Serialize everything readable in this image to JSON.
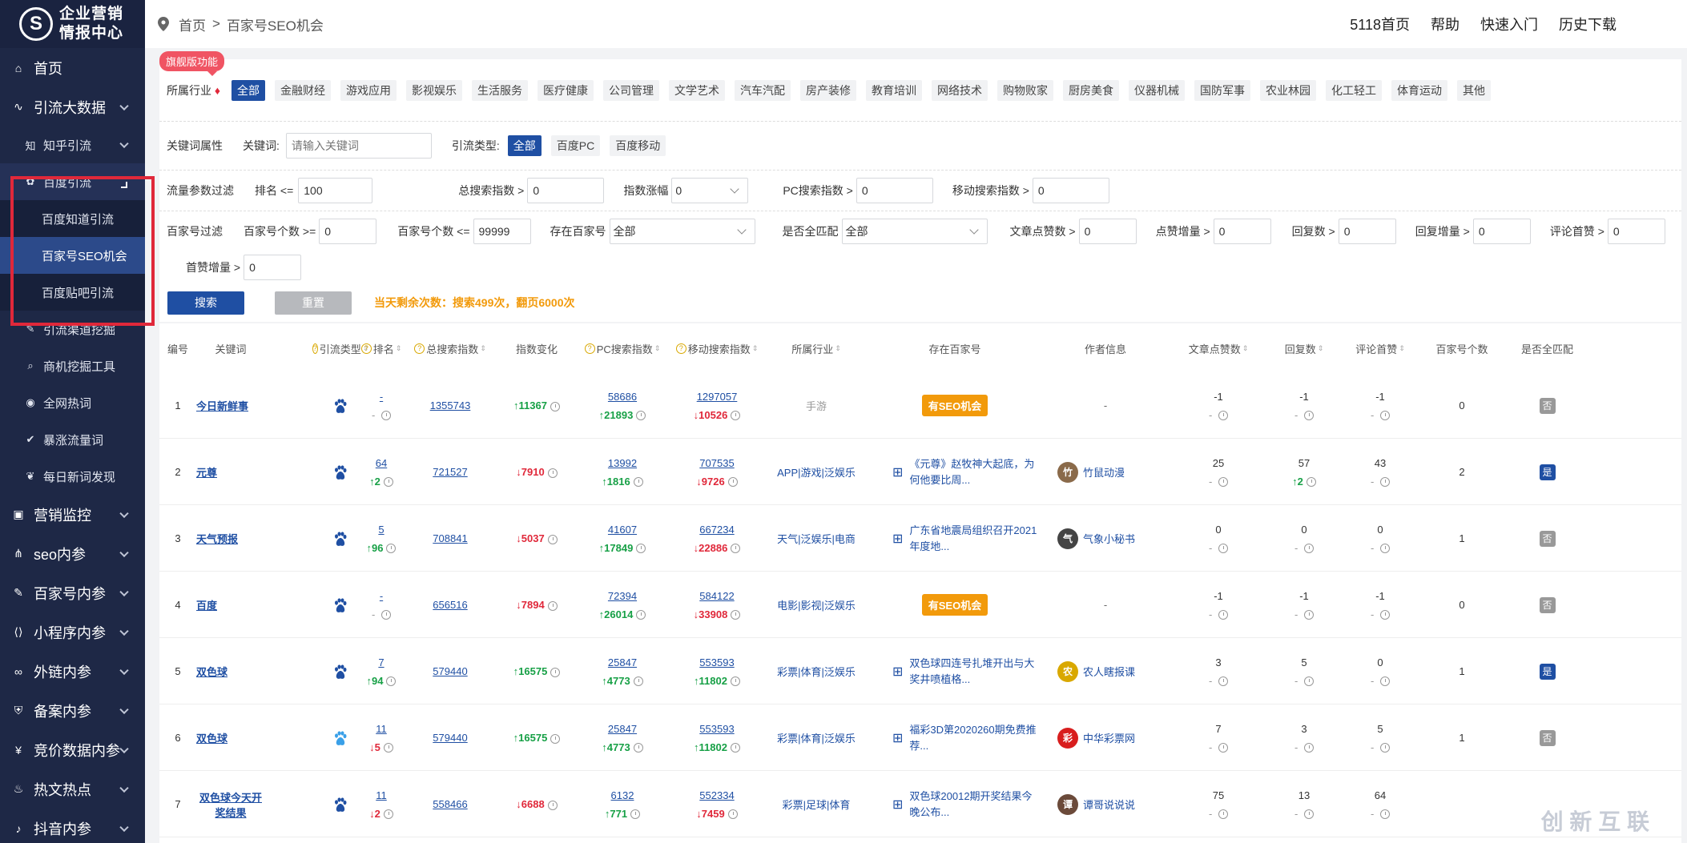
{
  "logo": {
    "line1": "企业营销",
    "line2": "情报中心"
  },
  "sidebar": {
    "home": "首页",
    "traffic": "引流大数据",
    "zhihu": "知乎引流",
    "baidu": "百度引流",
    "baidu_sub": [
      "百度知道引流",
      "百家号SEO机会",
      "百度贴吧引流"
    ],
    "others": [
      "引流渠道挖掘",
      "商机挖掘工具",
      "全网热词",
      "暴涨流量词",
      "每日新词发现"
    ],
    "groups": [
      "营销监控",
      "seo内参",
      "百家号内参",
      "小程序内参",
      "外链内参",
      "备案内参",
      "竞价数据内参",
      "热文热点",
      "抖音内参"
    ]
  },
  "breadcrumb": {
    "home": "首页",
    "sep": ">",
    "current": "百家号SEO机会"
  },
  "top_links": [
    "5118首页",
    "帮助",
    "快速入门",
    "历史下载"
  ],
  "filters": {
    "flag": "旗舰版功能",
    "industry_label": "所属行业",
    "industries": [
      "全部",
      "金融财经",
      "游戏应用",
      "影视娱乐",
      "生活服务",
      "医疗健康",
      "公司管理",
      "文学艺术",
      "汽车汽配",
      "房产装修",
      "教育培训",
      "网络技术",
      "购物败家",
      "厨房美食",
      "仪器机械",
      "国防军事",
      "农业林园",
      "化工轻工",
      "体育运动",
      "其他"
    ],
    "kw_attr": "关键词属性",
    "kw_label": "关键词:",
    "kw_placeholder": "请输入关键词",
    "type_label": "引流类型:",
    "types": [
      "全部",
      "百度PC",
      "百度移动"
    ],
    "flow_label": "流量参数过滤",
    "rank_label": "排名 <=",
    "rank_value": "100",
    "total_label": "总搜索指数 >",
    "total_value": "0",
    "change_label": "指数涨幅",
    "change_value": "0",
    "pc_label": "PC搜索指数 >",
    "pc_value": "0",
    "mobile_label": "移动搜索指数 >",
    "mobile_value": "0",
    "bjh_label": "百家号过滤",
    "bjh_min_label": "百家号个数 >=",
    "bjh_min_value": "0",
    "bjh_max_label": "百家号个数 <=",
    "bjh_max_value": "99999",
    "exist_label": "存在百家号",
    "exist_value": "全部",
    "match_label": "是否全匹配",
    "match_value": "全部",
    "likes_label": "文章点赞数 >",
    "likes_value": "0",
    "like_inc_label": "点赞增量 >",
    "like_inc_value": "0",
    "reply_label": "回复数 >",
    "reply_value": "0",
    "reply_inc_label": "回复增量 >",
    "reply_inc_value": "0",
    "first_like_label": "评论首赞 >",
    "first_like_value": "0",
    "first_inc_label": "首赞增量 >",
    "first_inc_value": "0",
    "search_btn": "搜索",
    "reset_btn": "重置",
    "remaining": "当天剩余次数：搜索499次，翻页6000次"
  },
  "table": {
    "headers": [
      "编号",
      "关键词",
      "引流类型",
      "排名",
      "总搜索指数",
      "指数变化",
      "PC搜索指数",
      "移动搜索指数",
      "所属行业",
      "存在百家号",
      "作者信息",
      "文章点赞数",
      "回复数",
      "评论首赞",
      "百家号个数",
      "是否全匹配"
    ],
    "rows": [
      {
        "no": "1",
        "kw": "今日新鲜事",
        "paw": "#1f4fa3",
        "rank": "-",
        "rank_sub": "-",
        "total": "1355743",
        "chg": "11367",
        "chg_dir": "up",
        "pc": "58686",
        "pc_chg": "21893",
        "pc_dir": "up",
        "mob": "1297057",
        "mob_chg": "10526",
        "mob_dir": "down",
        "ind": "手游",
        "ind_gray": true,
        "seo": "有SEO机会",
        "art": "",
        "author": "-",
        "av": "",
        "avc": "",
        "likes": "-1",
        "reply": "-1",
        "reply_chg": "",
        "first": "-1",
        "count": "0",
        "match": "否"
      },
      {
        "no": "2",
        "kw": "元尊",
        "paw": "#1f4fa3",
        "rank": "64",
        "rank_sub": "2",
        "total": "721527",
        "chg": "7910",
        "chg_dir": "down",
        "pc": "13992",
        "pc_chg": "1816",
        "pc_dir": "up",
        "mob": "707535",
        "mob_chg": "9726",
        "mob_dir": "down",
        "ind": "APP|游戏|泛娱乐",
        "ind_gray": false,
        "seo": "",
        "art": "《元尊》赵牧神大起底，为何他要比周...",
        "author": "竹鼠动漫",
        "av": "竹",
        "avc": "#8a6a4a",
        "likes": "25",
        "reply": "57",
        "reply_chg": "2",
        "first": "43",
        "count": "2",
        "match": "是"
      },
      {
        "no": "3",
        "kw": "天气预报",
        "paw": "#1f4fa3",
        "rank": "5",
        "rank_sub": "96",
        "total": "708841",
        "chg": "5037",
        "chg_dir": "down",
        "pc": "41607",
        "pc_chg": "17849",
        "pc_dir": "up",
        "mob": "667234",
        "mob_chg": "22886",
        "mob_dir": "down",
        "ind": "天气|泛娱乐|电商",
        "ind_gray": false,
        "seo": "",
        "art": "广东省地震局组织召开2021年度地...",
        "author": "气象小秘书",
        "av": "气",
        "avc": "#444",
        "likes": "0",
        "reply": "0",
        "reply_chg": "",
        "first": "0",
        "count": "1",
        "match": "否"
      },
      {
        "no": "4",
        "kw": "百度",
        "paw": "#1f4fa3",
        "rank": "-",
        "rank_sub": "-",
        "total": "656516",
        "chg": "7894",
        "chg_dir": "down",
        "pc": "72394",
        "pc_chg": "26014",
        "pc_dir": "up",
        "mob": "584122",
        "mob_chg": "33908",
        "mob_dir": "down",
        "ind": "电影|影视|泛娱乐",
        "ind_gray": false,
        "seo": "有SEO机会",
        "art": "",
        "author": "-",
        "av": "",
        "avc": "",
        "likes": "-1",
        "reply": "-1",
        "reply_chg": "",
        "first": "-1",
        "count": "0",
        "match": "否"
      },
      {
        "no": "5",
        "kw": "双色球",
        "paw": "#1f4fa3",
        "rank": "7",
        "rank_sub": "94",
        "total": "579440",
        "chg": "16575",
        "chg_dir": "up",
        "pc": "25847",
        "pc_chg": "4773",
        "pc_dir": "up",
        "mob": "553593",
        "mob_chg": "11802",
        "mob_dir": "up",
        "ind": "彩票|体育|泛娱乐",
        "ind_gray": false,
        "seo": "",
        "art": "双色球四连号扎堆开出与大奖井喷植格...",
        "author": "农人瞎报课",
        "av": "农",
        "avc": "#d9a800",
        "likes": "3",
        "reply": "5",
        "reply_chg": "",
        "first": "0",
        "count": "1",
        "match": "是"
      },
      {
        "no": "6",
        "kw": "双色球",
        "paw": "#3aa0e8",
        "rank": "11",
        "rank_sub": "5",
        "total": "579440",
        "chg": "16575",
        "chg_dir": "up",
        "pc": "25847",
        "pc_chg": "4773",
        "pc_dir": "up",
        "mob": "553593",
        "mob_chg": "11802",
        "mob_dir": "up",
        "ind": "彩票|体育|泛娱乐",
        "ind_gray": false,
        "seo": "",
        "art": "福彩3D第2020260期免费推荐...",
        "author": "中华彩票网",
        "av": "彩",
        "avc": "#d81e1e",
        "likes": "7",
        "reply": "3",
        "reply_chg": "",
        "first": "5",
        "count": "1",
        "match": "否"
      },
      {
        "no": "7",
        "kw": "双色球今天开奖结果",
        "paw": "#1f4fa3",
        "rank": "11",
        "rank_sub": "2",
        "total": "558466",
        "chg": "6688",
        "chg_dir": "down",
        "pc": "6132",
        "pc_chg": "771",
        "pc_dir": "up",
        "mob": "552334",
        "mob_chg": "7459",
        "mob_dir": "down",
        "ind": "彩票|足球|体育",
        "ind_gray": false,
        "seo": "",
        "art": "双色球20012期开奖结果今晚公布...",
        "author": "谭哥说说说",
        "av": "谭",
        "avc": "#6b4a3a",
        "likes": "75",
        "reply": "13",
        "reply_chg": "",
        "first": "64",
        "count": "",
        "match": ""
      }
    ]
  },
  "watermark": "创 新 互 联",
  "colors": {
    "sidebar": "#1e2846",
    "accent": "#1f4fa3",
    "up": "#17a046",
    "down": "#e0283a",
    "seo": "#f29a0b",
    "flag": "#f05463"
  }
}
